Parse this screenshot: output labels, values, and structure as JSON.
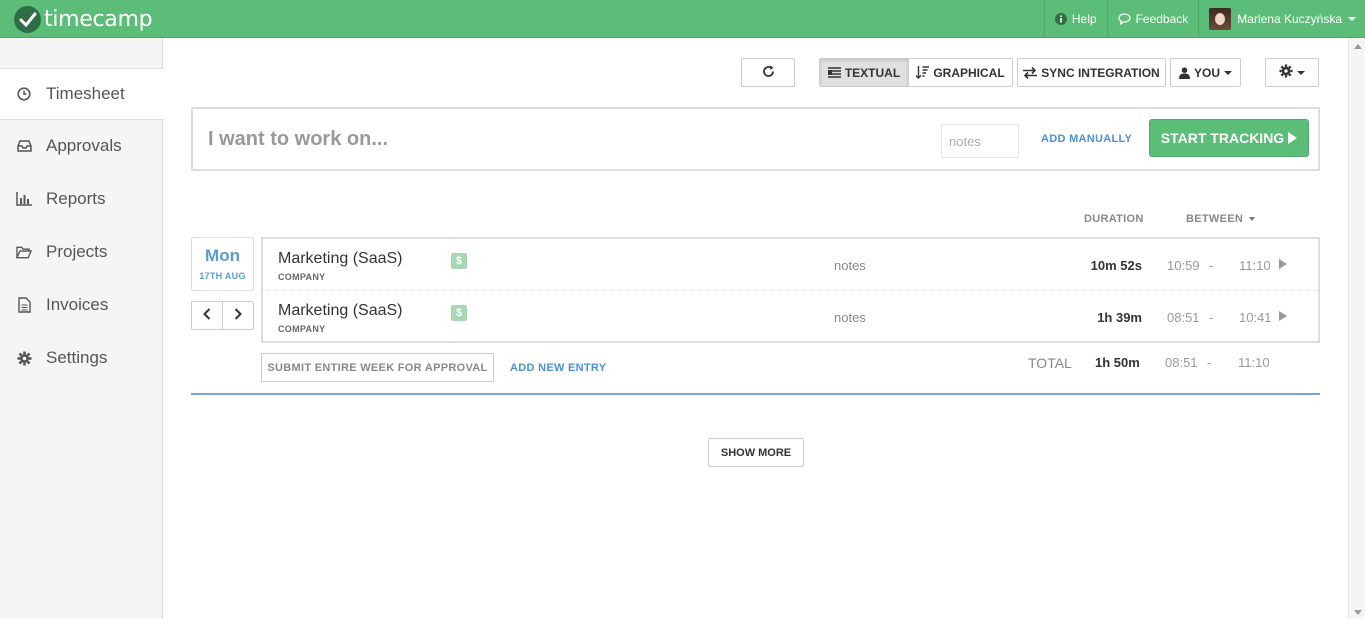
{
  "brand": {
    "name": "timecamp"
  },
  "topbar": {
    "help": "Help",
    "feedback": "Feedback",
    "user": "Marlena Kuczyńska"
  },
  "sidebar": {
    "items": [
      {
        "label": "Timesheet",
        "icon": "clock-icon",
        "active": true
      },
      {
        "label": "Approvals",
        "icon": "inbox-icon",
        "active": false
      },
      {
        "label": "Reports",
        "icon": "bar-chart-icon",
        "active": false
      },
      {
        "label": "Projects",
        "icon": "folder-icon",
        "active": false
      },
      {
        "label": "Invoices",
        "icon": "document-icon",
        "active": false
      },
      {
        "label": "Settings",
        "icon": "gear-icon",
        "active": false
      }
    ]
  },
  "toolbar": {
    "textual": "TEXTUAL",
    "graphical": "GRAPHICAL",
    "sync": "SYNC INTEGRATION",
    "you": "YOU"
  },
  "tracker": {
    "placeholder": "I want to work on...",
    "notes_placeholder": "notes",
    "add_manually": "ADD MANUALLY",
    "start": "START TRACKING"
  },
  "columns": {
    "duration": "DURATION",
    "between": "BETWEEN"
  },
  "day": {
    "name": "Mon",
    "date": "17TH AUG"
  },
  "entries": [
    {
      "title": "Marketing (SaaS)",
      "sub": "COMPANY",
      "billable": "$",
      "notes": "notes",
      "duration": "10m 52s",
      "start": "10:59",
      "dash": "-",
      "end": "11:10"
    },
    {
      "title": "Marketing (SaaS)",
      "sub": "COMPANY",
      "billable": "$",
      "notes": "notes",
      "duration": "1h 39m",
      "start": "08:51",
      "dash": "-",
      "end": "10:41"
    }
  ],
  "footer": {
    "submit": "SUBMIT ENTIRE WEEK FOR APPROVAL",
    "add_entry": "ADD NEW ENTRY",
    "total_label": "TOTAL",
    "total_duration": "1h 50m",
    "total_start": "08:51",
    "total_dash": "-",
    "total_end": "11:10"
  },
  "show_more": "SHOW MORE",
  "colors": {
    "brand_green": "#5bbd77",
    "link_blue": "#4a90d9"
  }
}
